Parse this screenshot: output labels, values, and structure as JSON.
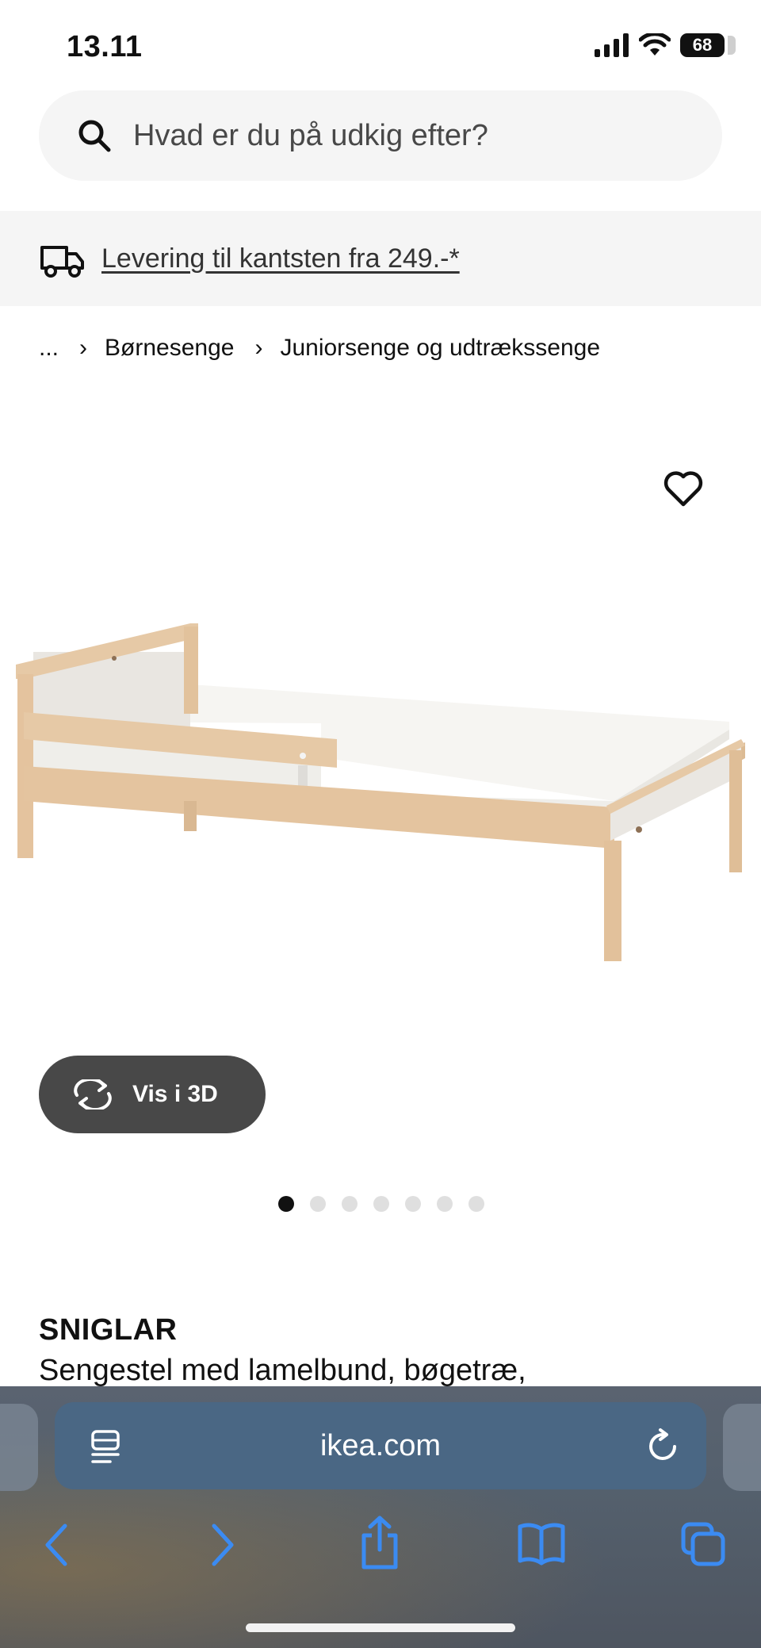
{
  "status": {
    "time": "13.11",
    "battery": "68"
  },
  "search": {
    "placeholder": "Hvad er du på udkig efter?"
  },
  "delivery": {
    "text": "Levering til kantsten fra 249.-*"
  },
  "breadcrumb": {
    "items": [
      "...",
      "Børnesenge",
      "Juniorsenge og udtrækssenge"
    ]
  },
  "product": {
    "view3d_label": "Vis i 3D",
    "image_count": 7,
    "active_image": 1,
    "name": "SNIGLAR",
    "description": "Sengestel med lamelbund, bøgetræ,"
  },
  "browser": {
    "url": "ikea.com"
  },
  "icons": [
    "search-icon",
    "truck-icon",
    "heart-icon",
    "rotate-3d-icon",
    "reader-icon",
    "reload-icon",
    "back-icon",
    "forward-icon",
    "share-icon",
    "bookmarks-icon",
    "tabs-icon"
  ],
  "colors": {
    "accent_blue": "#3b82f6",
    "button_dark": "#484848",
    "wood": "#e6c9a6"
  }
}
